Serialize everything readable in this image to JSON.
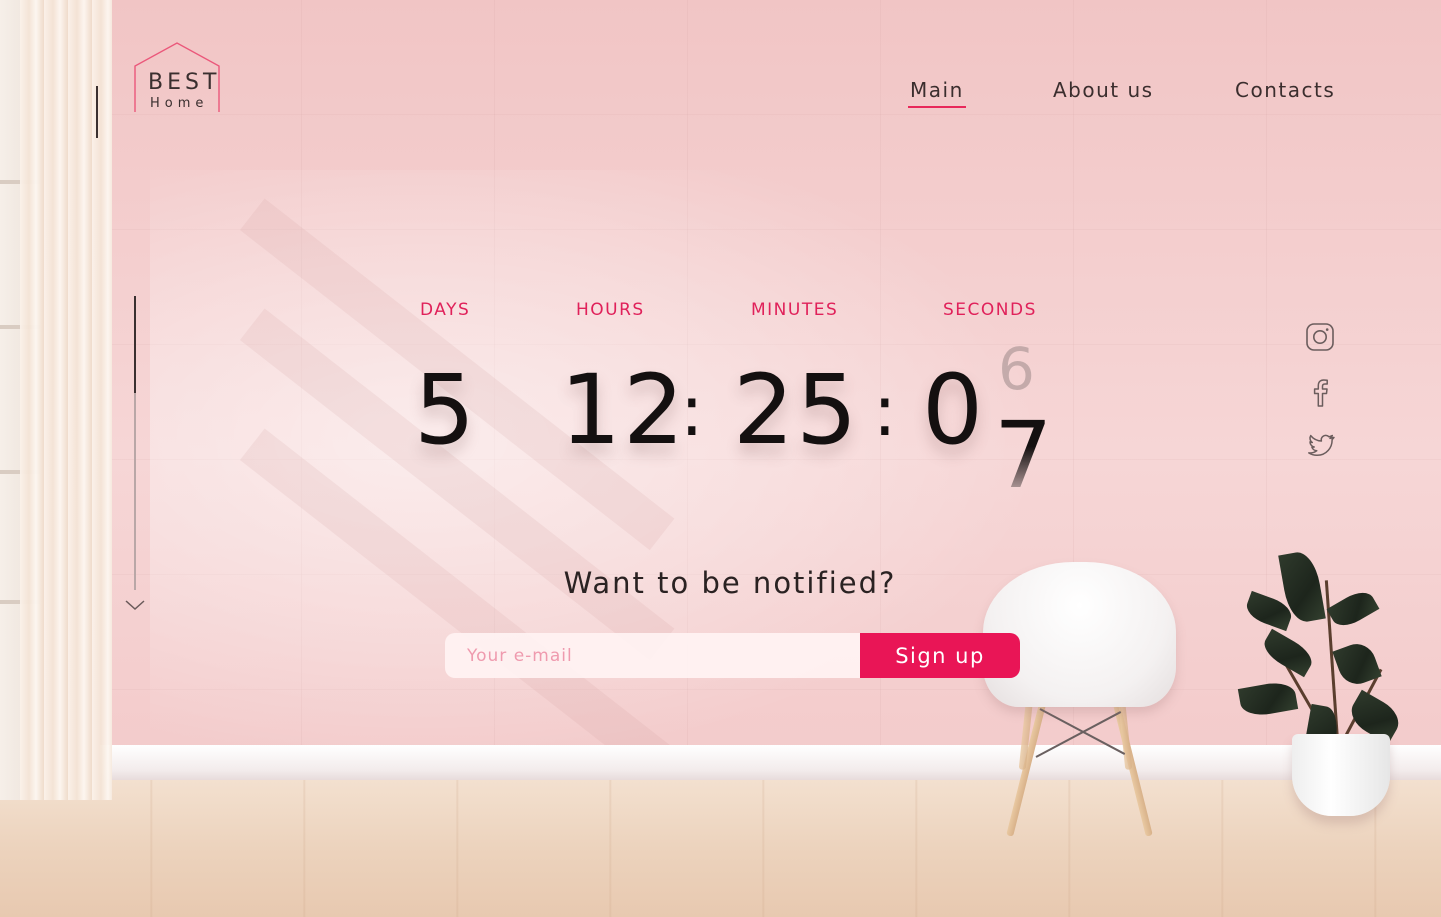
{
  "brand": {
    "name": "BEST",
    "sub": "Home",
    "accent_color": "#e8285a"
  },
  "nav": {
    "items": [
      {
        "label": "Main",
        "active": true
      },
      {
        "label": "About us",
        "active": false
      },
      {
        "label": "Contacts",
        "active": false
      }
    ]
  },
  "countdown": {
    "labels": {
      "days": "DAYS",
      "hours": "HOURS",
      "minutes": "MINUTES",
      "seconds": "SECONDS"
    },
    "values": {
      "days": "5",
      "hours": "12",
      "minutes": "25",
      "seconds_tens": "0",
      "seconds_ones_outgoing": "7",
      "seconds_ones_incoming": "6"
    },
    "separator": ":"
  },
  "notify": {
    "title": "Want to be notified?",
    "email_placeholder": "Your e-mail",
    "button_label": "Sign up",
    "button_color": "#e91556"
  },
  "social": {
    "icons": [
      "instagram-icon",
      "facebook-icon",
      "twitter-icon"
    ]
  },
  "scroll": {
    "progress": 0.33
  }
}
